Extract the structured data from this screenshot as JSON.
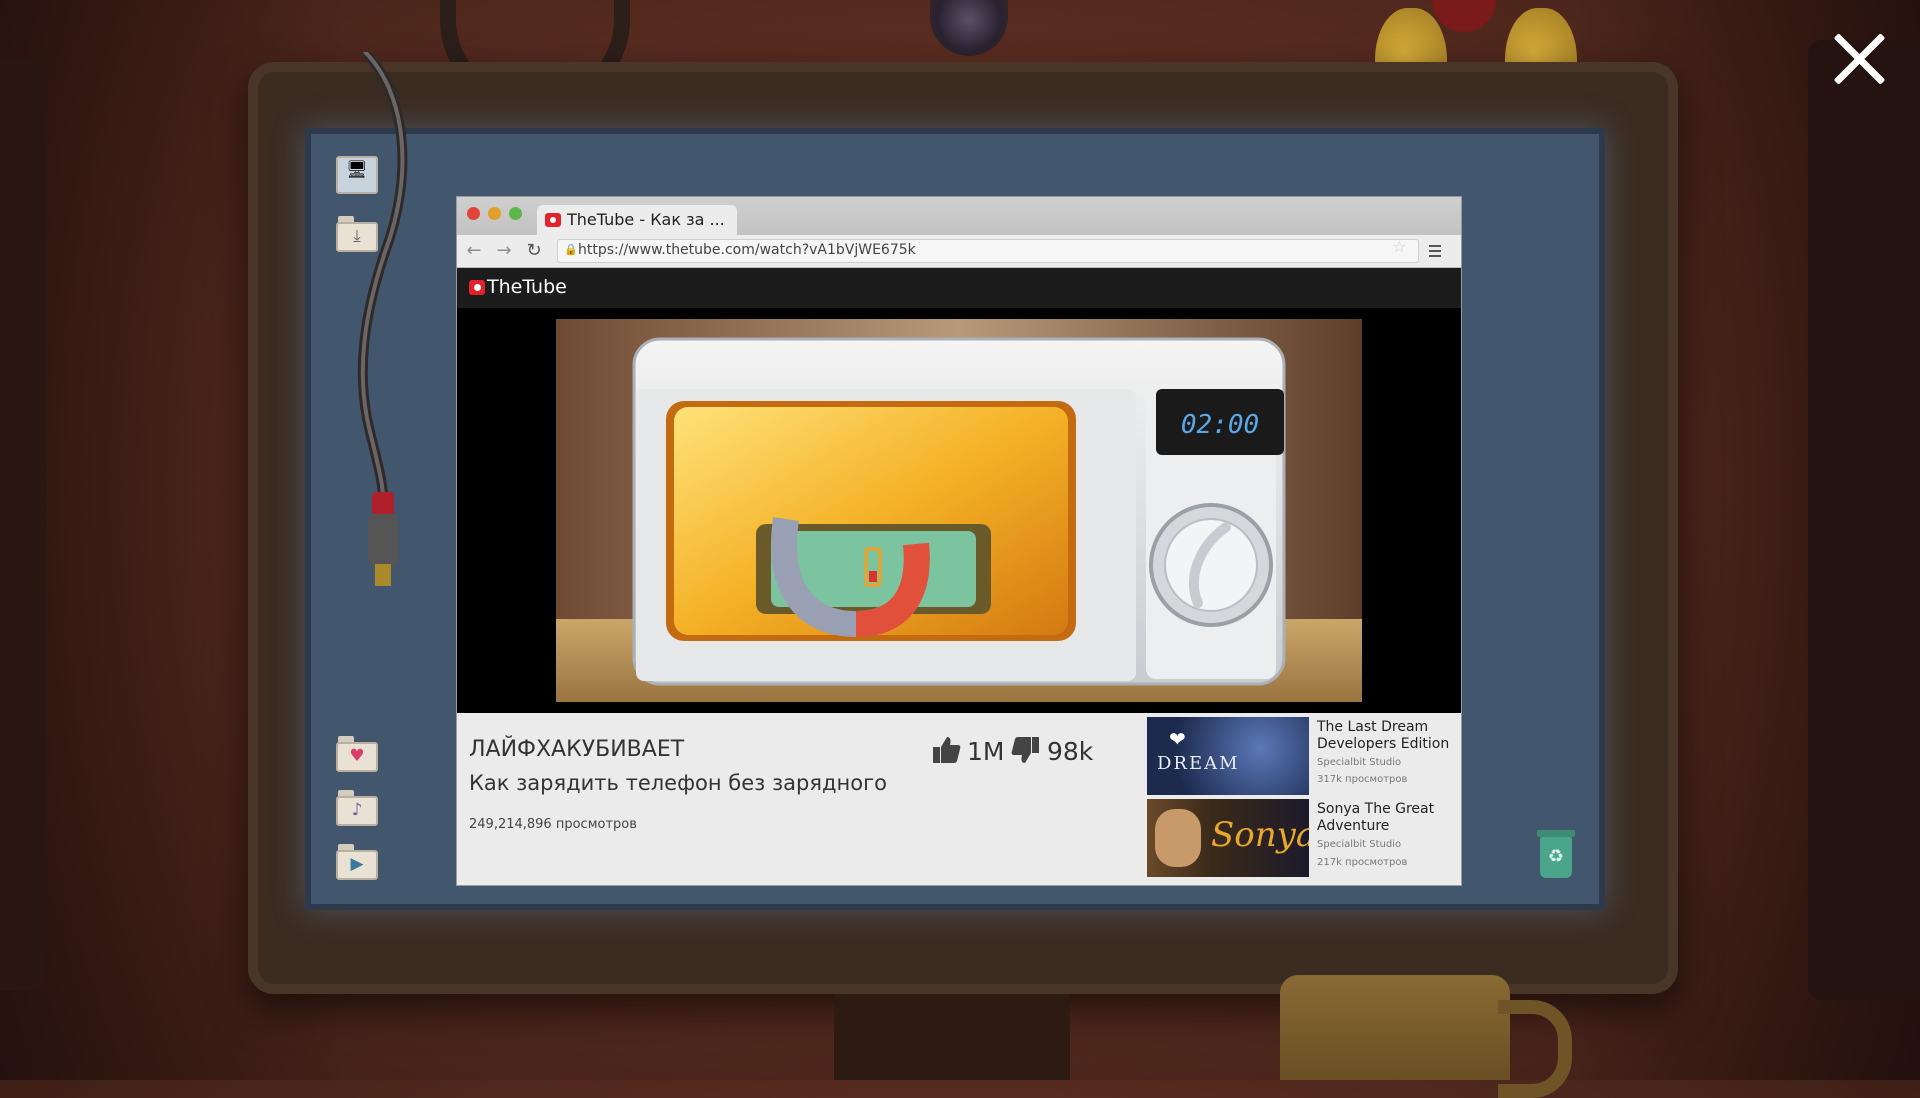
{
  "game": {
    "close_label": "✕"
  },
  "desktop": {
    "icons": [
      "computer-icon",
      "downloads-folder-icon",
      "favorites-folder-icon",
      "music-folder-icon",
      "video-folder-icon"
    ],
    "recycle_glyph": "♻"
  },
  "browser": {
    "tab_title": "TheTube - Как за ...",
    "url": "https://www.thetube.com/watch?vA1bVjWE675k",
    "nav": {
      "back": "←",
      "forward": "→",
      "reload": "↻"
    },
    "star": "☆"
  },
  "site": {
    "name": "TheTube"
  },
  "video": {
    "microwave_display": "02:00",
    "channel": "ЛАЙФХАКУБИВАЕТ",
    "title": "Как зарядить телефон без зарядного",
    "views": "249,214,896 просмотров",
    "likes": "1M",
    "dislikes": "98k"
  },
  "recommendations": [
    {
      "title": "The Last Dream Developers Edition",
      "studio": "Specialbit Studio",
      "views": "317k просмотров",
      "thumb_text": "DREAM"
    },
    {
      "title": "Sonya The Great Adventure",
      "studio": "Specialbit Studio",
      "views": "217k просмотров",
      "thumb_text": "Sonya"
    }
  ],
  "colors": {
    "brand_red": "#e3222b",
    "screen_blue": "#42566e",
    "player_black": "#000000"
  }
}
